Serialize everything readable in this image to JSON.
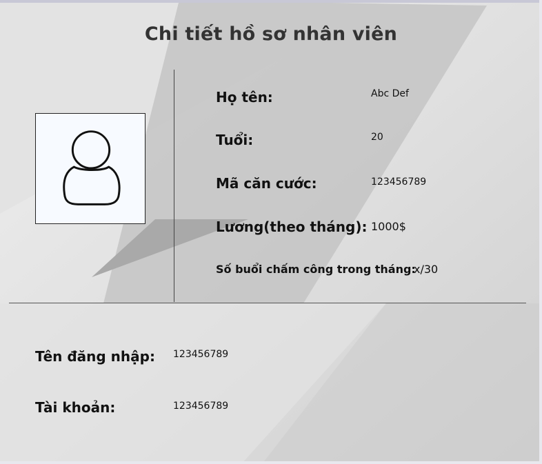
{
  "window": {
    "title": "Chi tiết hồ sơ nhân viên"
  },
  "colors": {
    "background": "#dcdcdc",
    "text": "#111111",
    "avatar_bg": "#f7faff"
  },
  "avatar": {
    "icon": "user-icon"
  },
  "profile": {
    "name_label": "Họ tên:",
    "name_value": "Abc Def",
    "age_label": "Tuổi:",
    "age_value": "20",
    "id_label": "Mã căn cước:",
    "id_value": "123456789",
    "salary_label": "Lương(theo tháng):",
    "salary_value": "1000$",
    "attendance_label": "Số buổi chấm công trong tháng:",
    "attendance_value": "x/30"
  },
  "account": {
    "username_label": "Tên đăng nhập:",
    "username_value": "123456789",
    "account_label": "Tài khoản:",
    "account_value": "123456789"
  }
}
